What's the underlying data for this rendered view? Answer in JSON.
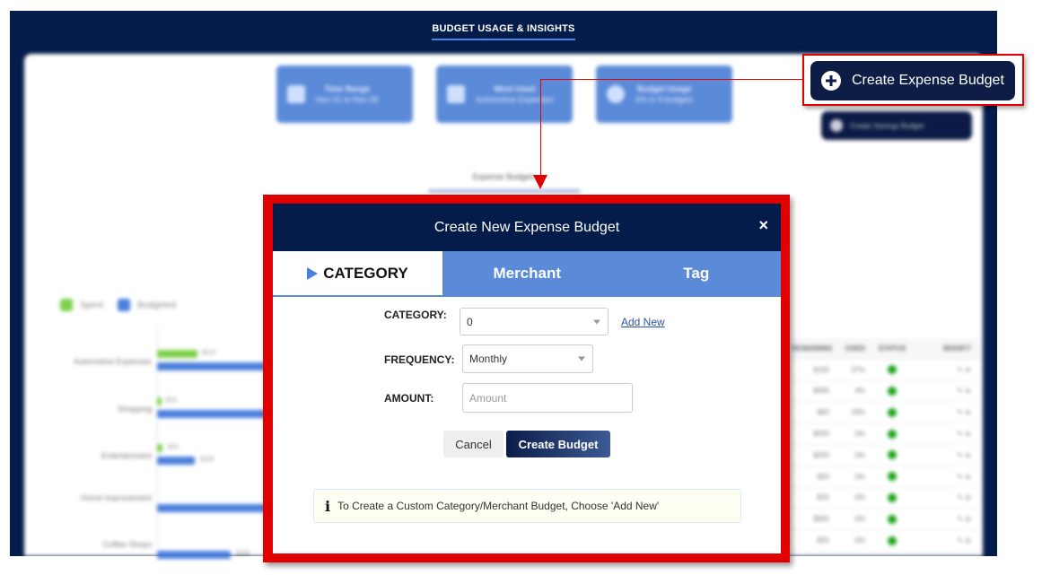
{
  "app": {
    "title": "BUDGET USAGE & INSIGHTS",
    "colors": {
      "navy": "#041c4a",
      "accent": "#5a8ad8",
      "highlight": "#e00000",
      "spent": "#7ed04b",
      "budgeted": "#4a7fdc",
      "status_ok": "#18a21a"
    }
  },
  "background": {
    "stats": [
      {
        "title": "Time Range",
        "value": "Nov 01 to Nov 06",
        "icon": "calendar-icon"
      },
      {
        "title": "Most Used",
        "value": "Automotive Expenses",
        "icon": "money-icon"
      },
      {
        "title": "Budget Usage",
        "value": "6% in 9 budgets",
        "icon": "pie-icon"
      }
    ],
    "create_savings_label": "Create Savings Budget",
    "expense_tab_label": "Expense Budgets",
    "legend": {
      "spent": "Spent",
      "budgeted": "Budgeted"
    },
    "chart_rows": [
      {
        "label": "Automotive Expenses",
        "spent": "$110",
        "budgeted": ""
      },
      {
        "label": "Shopping",
        "spent": "$15",
        "budgeted": ""
      },
      {
        "label": "Entertainment",
        "spent": "$18",
        "budgeted": "$100"
      },
      {
        "label": "Home Improvement",
        "spent": "",
        "budgeted": ""
      },
      {
        "label": "Coffee Shops",
        "spent": "",
        "budgeted": "$200"
      }
    ],
    "table": {
      "headers": [
        "REMAINING",
        "USED",
        "STATUS",
        "MODIFY"
      ],
      "rows": [
        {
          "remaining": "$190",
          "used": "37%"
        },
        {
          "remaining": "$385",
          "used": "4%"
        },
        {
          "remaining": "$82",
          "used": "18%"
        },
        {
          "remaining": "$300",
          "used": "0%"
        },
        {
          "remaining": "$200",
          "used": "0%"
        },
        {
          "remaining": "$50",
          "used": "0%"
        },
        {
          "remaining": "$25",
          "used": "0%"
        },
        {
          "remaining": "$800",
          "used": "0%"
        },
        {
          "remaining": "$55",
          "used": "0%"
        }
      ]
    }
  },
  "callout": {
    "label": "Create Expense Budget",
    "icon": "plus-circle-icon"
  },
  "modal": {
    "title": "Create New Expense Budget",
    "close_label": "×",
    "tabs": [
      {
        "label": "CATEGORY",
        "active": true
      },
      {
        "label": "Merchant",
        "active": false
      },
      {
        "label": "Tag",
        "active": false
      }
    ],
    "fields": {
      "category": {
        "label": "CATEGORY:",
        "value": "0"
      },
      "add_new": "Add New",
      "frequency": {
        "label": "FREQUENCY:",
        "value": "Monthly"
      },
      "amount": {
        "label": "AMOUNT:",
        "placeholder": "Amount",
        "value": ""
      }
    },
    "buttons": {
      "cancel": "Cancel",
      "create": "Create Budget"
    },
    "info": "To Create a Custom Category/Merchant Budget, Choose 'Add New'"
  }
}
